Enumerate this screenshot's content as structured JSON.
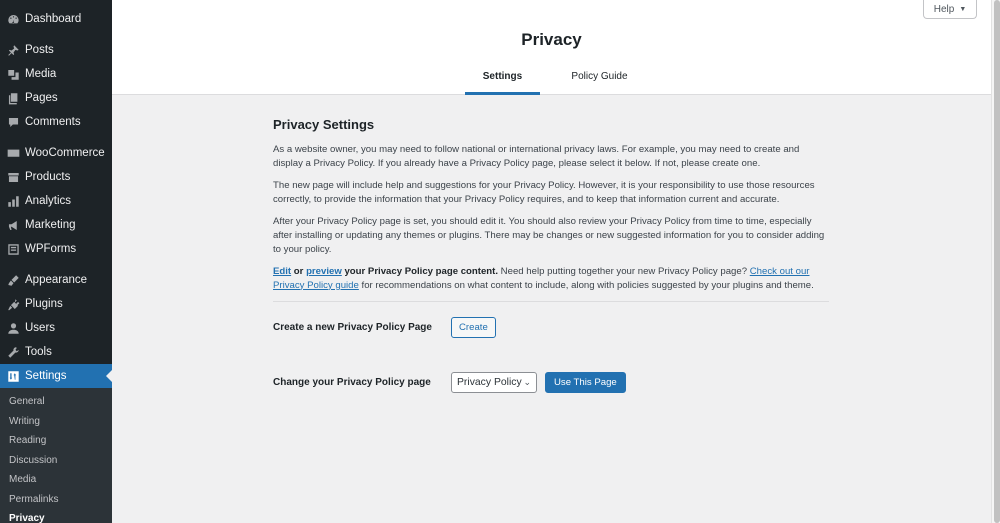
{
  "sidebar": {
    "items": [
      {
        "label": "Dashboard",
        "icon": "dashboard-icon"
      },
      {
        "label": "Posts",
        "icon": "pin-icon"
      },
      {
        "label": "Media",
        "icon": "media-icon"
      },
      {
        "label": "Pages",
        "icon": "pages-icon"
      },
      {
        "label": "Comments",
        "icon": "comment-icon"
      },
      {
        "label": "WooCommerce",
        "icon": "woocommerce-icon"
      },
      {
        "label": "Products",
        "icon": "archive-icon"
      },
      {
        "label": "Analytics",
        "icon": "bar-chart-icon"
      },
      {
        "label": "Marketing",
        "icon": "megaphone-icon"
      },
      {
        "label": "WPForms",
        "icon": "form-icon"
      },
      {
        "label": "Appearance",
        "icon": "paintbrush-icon"
      },
      {
        "label": "Plugins",
        "icon": "plugin-icon"
      },
      {
        "label": "Users",
        "icon": "user-icon"
      },
      {
        "label": "Tools",
        "icon": "wrench-icon"
      },
      {
        "label": "Settings",
        "icon": "settings-icon",
        "active": true
      }
    ],
    "submenu": [
      {
        "label": "General"
      },
      {
        "label": "Writing"
      },
      {
        "label": "Reading"
      },
      {
        "label": "Discussion"
      },
      {
        "label": "Media"
      },
      {
        "label": "Permalinks"
      },
      {
        "label": "Privacy",
        "current": true
      }
    ]
  },
  "header": {
    "title": "Privacy",
    "tabs": [
      {
        "label": "Settings",
        "active": true
      },
      {
        "label": "Policy Guide",
        "active": false
      }
    ],
    "help_label": "Help",
    "help_caret": "▼"
  },
  "content": {
    "section_title": "Privacy Settings",
    "paragraphs": [
      "As a website owner, you may need to follow national or international privacy laws. For example, you may need to create and display a Privacy Policy. If you already have a Privacy Policy page, please select it below. If not, please create one.",
      "The new page will include help and suggestions for your Privacy Policy. However, it is your responsibility to use those resources correctly, to provide the information that your Privacy Policy requires, and to keep that information current and accurate.",
      "After your Privacy Policy page is set, you should edit it. You should also review your Privacy Policy from time to time, especially after installing or updating any themes or plugins. There may be changes or new suggested information for you to consider adding to your policy."
    ],
    "edit_link": "Edit",
    "or_text": " or ",
    "preview_link": "preview",
    "bold_tail": " your Privacy Policy page content.",
    "help_text": " Need help putting together your new Privacy Policy page? ",
    "guide_link": "Check out our Privacy Policy guide",
    "guide_tail": " for recommendations on what content to include, along with policies suggested by your plugins and theme.",
    "create_row": {
      "label": "Create a new Privacy Policy Page",
      "button": "Create"
    },
    "change_row": {
      "label": "Change your Privacy Policy page",
      "selected": "Privacy Policy",
      "chevron": "⌄",
      "button": "Use This Page"
    }
  },
  "colors": {
    "accent": "#2271b1",
    "sidebar_bg": "#1d2327",
    "page_bg": "#f0f0f1"
  }
}
